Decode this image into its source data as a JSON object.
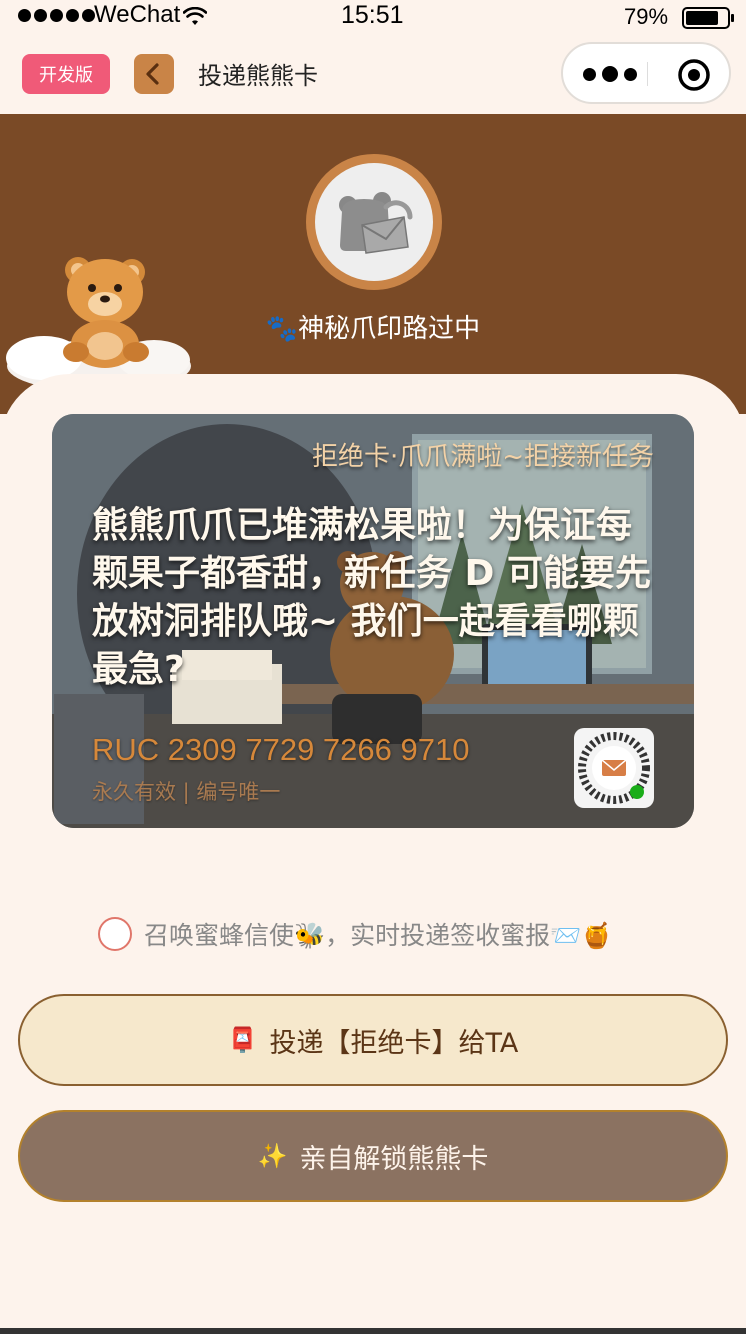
{
  "status_bar": {
    "carrier": "WeChat",
    "time": "15:51",
    "battery_percent": "79%",
    "battery_level": 0.79
  },
  "nav": {
    "dev_badge": "开发版",
    "title": "投递熊熊卡"
  },
  "header": {
    "status_icon": "paw-icon",
    "status_text": "🐾神秘爪印路过中"
  },
  "card": {
    "header": "拒绝卡·爪爪满啦~拒接新任务",
    "message": "熊熊爪爪已堆满松果啦！为保证每颗果子都香甜，新任务 D 可能要先放树洞排队哦~ 我们一起看看哪颗最急?",
    "code": "RUC 2309 7729 7266 9710",
    "validity": "永久有效 | 编号唯一"
  },
  "notify": {
    "label": "召唤蜜蜂信使🐝，实时投递签收蜜报📨🍯",
    "checked": false
  },
  "buttons": {
    "deliver_icon": "📮",
    "deliver_label": "投递【拒绝卡】给TA",
    "unlock_icon": "✨",
    "unlock_label": "亲自解锁熊熊卡"
  },
  "colors": {
    "background": "#fdf3ec",
    "header_brown": "#7a4a26",
    "accent_orange": "#c98447",
    "dev_badge": "#f05a78",
    "deliver_button_bg": "#f6e8cc",
    "unlock_button_bg": "#8b7261"
  }
}
